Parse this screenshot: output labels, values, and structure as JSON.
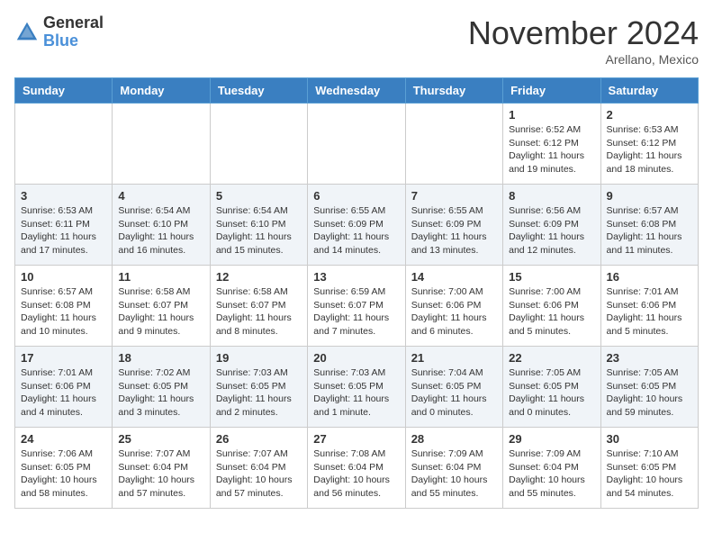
{
  "header": {
    "logo_line1": "General",
    "logo_line2": "Blue",
    "month": "November 2024",
    "location": "Arellano, Mexico"
  },
  "weekdays": [
    "Sunday",
    "Monday",
    "Tuesday",
    "Wednesday",
    "Thursday",
    "Friday",
    "Saturday"
  ],
  "weeks": [
    [
      {
        "day": "",
        "info": ""
      },
      {
        "day": "",
        "info": ""
      },
      {
        "day": "",
        "info": ""
      },
      {
        "day": "",
        "info": ""
      },
      {
        "day": "",
        "info": ""
      },
      {
        "day": "1",
        "info": "Sunrise: 6:52 AM\nSunset: 6:12 PM\nDaylight: 11 hours and 19 minutes."
      },
      {
        "day": "2",
        "info": "Sunrise: 6:53 AM\nSunset: 6:12 PM\nDaylight: 11 hours and 18 minutes."
      }
    ],
    [
      {
        "day": "3",
        "info": "Sunrise: 6:53 AM\nSunset: 6:11 PM\nDaylight: 11 hours and 17 minutes."
      },
      {
        "day": "4",
        "info": "Sunrise: 6:54 AM\nSunset: 6:10 PM\nDaylight: 11 hours and 16 minutes."
      },
      {
        "day": "5",
        "info": "Sunrise: 6:54 AM\nSunset: 6:10 PM\nDaylight: 11 hours and 15 minutes."
      },
      {
        "day": "6",
        "info": "Sunrise: 6:55 AM\nSunset: 6:09 PM\nDaylight: 11 hours and 14 minutes."
      },
      {
        "day": "7",
        "info": "Sunrise: 6:55 AM\nSunset: 6:09 PM\nDaylight: 11 hours and 13 minutes."
      },
      {
        "day": "8",
        "info": "Sunrise: 6:56 AM\nSunset: 6:09 PM\nDaylight: 11 hours and 12 minutes."
      },
      {
        "day": "9",
        "info": "Sunrise: 6:57 AM\nSunset: 6:08 PM\nDaylight: 11 hours and 11 minutes."
      }
    ],
    [
      {
        "day": "10",
        "info": "Sunrise: 6:57 AM\nSunset: 6:08 PM\nDaylight: 11 hours and 10 minutes."
      },
      {
        "day": "11",
        "info": "Sunrise: 6:58 AM\nSunset: 6:07 PM\nDaylight: 11 hours and 9 minutes."
      },
      {
        "day": "12",
        "info": "Sunrise: 6:58 AM\nSunset: 6:07 PM\nDaylight: 11 hours and 8 minutes."
      },
      {
        "day": "13",
        "info": "Sunrise: 6:59 AM\nSunset: 6:07 PM\nDaylight: 11 hours and 7 minutes."
      },
      {
        "day": "14",
        "info": "Sunrise: 7:00 AM\nSunset: 6:06 PM\nDaylight: 11 hours and 6 minutes."
      },
      {
        "day": "15",
        "info": "Sunrise: 7:00 AM\nSunset: 6:06 PM\nDaylight: 11 hours and 5 minutes."
      },
      {
        "day": "16",
        "info": "Sunrise: 7:01 AM\nSunset: 6:06 PM\nDaylight: 11 hours and 5 minutes."
      }
    ],
    [
      {
        "day": "17",
        "info": "Sunrise: 7:01 AM\nSunset: 6:06 PM\nDaylight: 11 hours and 4 minutes."
      },
      {
        "day": "18",
        "info": "Sunrise: 7:02 AM\nSunset: 6:05 PM\nDaylight: 11 hours and 3 minutes."
      },
      {
        "day": "19",
        "info": "Sunrise: 7:03 AM\nSunset: 6:05 PM\nDaylight: 11 hours and 2 minutes."
      },
      {
        "day": "20",
        "info": "Sunrise: 7:03 AM\nSunset: 6:05 PM\nDaylight: 11 hours and 1 minute."
      },
      {
        "day": "21",
        "info": "Sunrise: 7:04 AM\nSunset: 6:05 PM\nDaylight: 11 hours and 0 minutes."
      },
      {
        "day": "22",
        "info": "Sunrise: 7:05 AM\nSunset: 6:05 PM\nDaylight: 11 hours and 0 minutes."
      },
      {
        "day": "23",
        "info": "Sunrise: 7:05 AM\nSunset: 6:05 PM\nDaylight: 10 hours and 59 minutes."
      }
    ],
    [
      {
        "day": "24",
        "info": "Sunrise: 7:06 AM\nSunset: 6:05 PM\nDaylight: 10 hours and 58 minutes."
      },
      {
        "day": "25",
        "info": "Sunrise: 7:07 AM\nSunset: 6:04 PM\nDaylight: 10 hours and 57 minutes."
      },
      {
        "day": "26",
        "info": "Sunrise: 7:07 AM\nSunset: 6:04 PM\nDaylight: 10 hours and 57 minutes."
      },
      {
        "day": "27",
        "info": "Sunrise: 7:08 AM\nSunset: 6:04 PM\nDaylight: 10 hours and 56 minutes."
      },
      {
        "day": "28",
        "info": "Sunrise: 7:09 AM\nSunset: 6:04 PM\nDaylight: 10 hours and 55 minutes."
      },
      {
        "day": "29",
        "info": "Sunrise: 7:09 AM\nSunset: 6:04 PM\nDaylight: 10 hours and 55 minutes."
      },
      {
        "day": "30",
        "info": "Sunrise: 7:10 AM\nSunset: 6:05 PM\nDaylight: 10 hours and 54 minutes."
      }
    ]
  ]
}
